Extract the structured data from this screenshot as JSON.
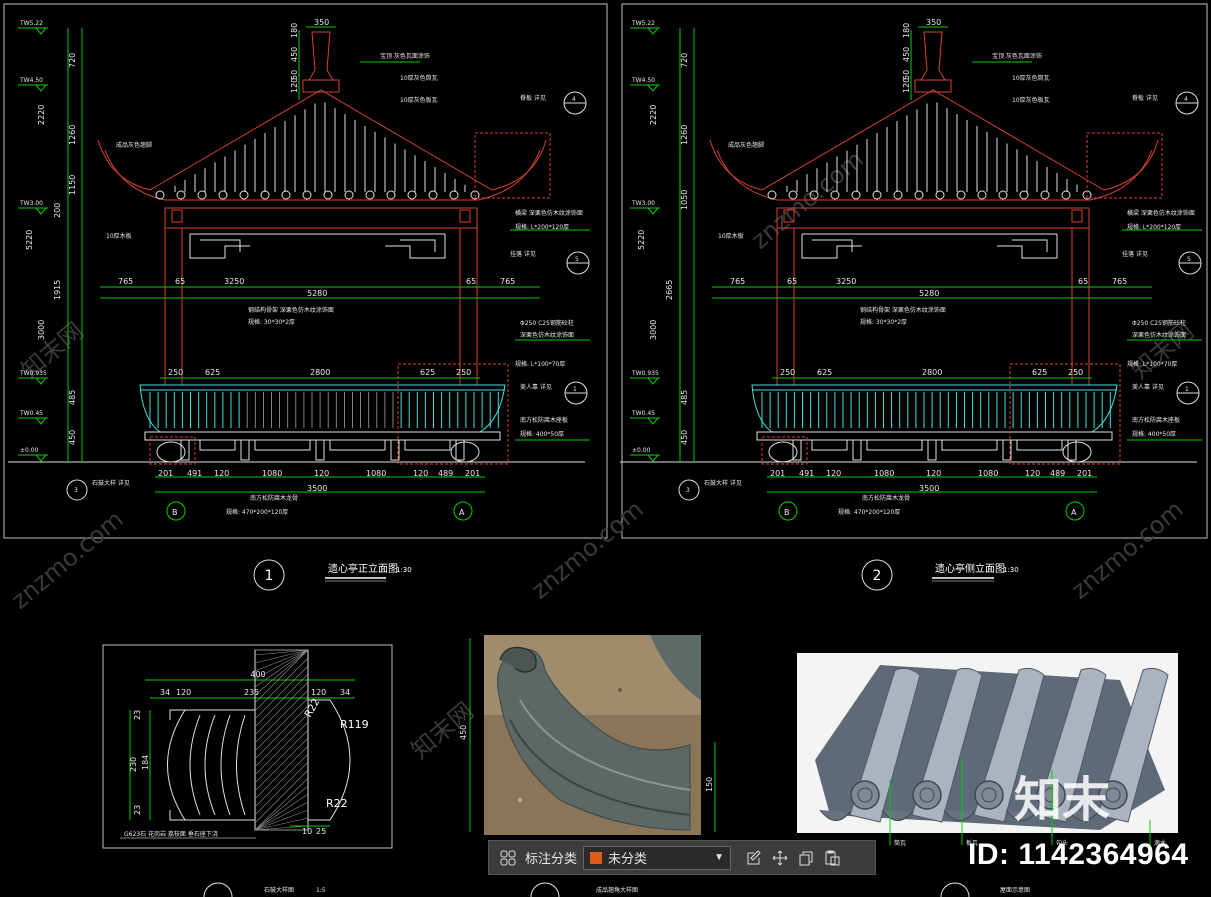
{
  "sheet1": {
    "number": "1",
    "title": "遗心亭正立面图",
    "scale": "1:30",
    "levels": [
      "TW5.22",
      "TW4.50",
      "TW3.00",
      "TW0.935",
      "TW0.45",
      "±0.00"
    ],
    "left_dims": [
      "720",
      "2220",
      "1260",
      "5220",
      "1150",
      "200",
      "3000",
      "1915",
      "485",
      "450"
    ],
    "top_dims": [
      "350",
      "180",
      "450",
      "50",
      "120"
    ],
    "span_dims": [
      "765",
      "65",
      "3250",
      "65",
      "765"
    ],
    "overall_dim": "5280",
    "mid_dims": [
      "250",
      "625",
      "2800",
      "625",
      "250"
    ],
    "base_dims": [
      "201",
      "491",
      "120",
      "1080",
      "120",
      "1080",
      "120",
      "489",
      "201"
    ],
    "base_total": "3500",
    "axis_left": "B",
    "axis_right": "A",
    "callout_bottom": "3",
    "notes": {
      "finial": "宝顶 灰色瓦面涂饰",
      "tile1": "10厚灰色筒瓦",
      "tile2": "10厚灰色板瓦",
      "eave": "成品灰色翘脚",
      "ridge": "脊板 详见",
      "beam": "横梁 深栗色仿木纹涂饰面",
      "beam_spec": "规格: L*200*120厚",
      "lattice": "挂落 详见",
      "column": "Φ250 C25钢筋砼柱",
      "column2": "深栗色仿木纹涂饰面",
      "rail": "规格: L*100*70厚",
      "seat": "美人靠 详见",
      "plank": "南方松防腐木座板",
      "plank_spec": "规格: 400*50厚",
      "steel": "钢结构骨架 深栗色仿木纹涂饰面",
      "steel_spec": "规格: 30*30*2厚",
      "board": "10厚木板",
      "base_note": "石鼓大样 详见",
      "joist": "南方松防腐木龙骨",
      "joist_spec": "规格: 470*200*120厚"
    }
  },
  "sheet2": {
    "number": "2",
    "title": "遗心亭侧立面图",
    "scale": "1:30",
    "left_dims": [
      "720",
      "2220",
      "1260",
      "5220",
      "1050",
      "2665",
      "3000",
      "485",
      "450"
    ]
  },
  "detail_drum": {
    "dims_top": [
      "400",
      "34",
      "120",
      "235",
      "120",
      "34"
    ],
    "dims_side": [
      "23",
      "230",
      "184",
      "23"
    ],
    "radii": [
      "R22",
      "R119",
      "R22"
    ],
    "bottom_dims": [
      "10",
      "25"
    ],
    "note": "G623石 花岗岩 荔枝面 垂石座下浇",
    "title": "石鼓大样图",
    "scale": "1:5"
  },
  "detail_eave_photo": {
    "dims": [
      "450",
      "150"
    ],
    "title": "成品翘角大样图"
  },
  "detail_tile_photo": {
    "labels": [
      "筒瓦",
      "板瓦",
      "勾头",
      "滴水"
    ],
    "title": "屋面示意图",
    "brand": "知末"
  },
  "watermark": "znzmo.com",
  "watermark_cn": "知末网",
  "id_label": "ID: 1142364964",
  "toolbar": {
    "grid_icon": "grid-icon",
    "label": "标注分类",
    "select_value": "未分类",
    "select_color": "#e05a1a",
    "icons": [
      "edit-icon",
      "move-icon",
      "copy-icon",
      "paste-icon"
    ]
  },
  "colors": {
    "dimension": "#00d000",
    "outline": "#d84030",
    "railing": "#40e0e0",
    "background": "#000000"
  }
}
